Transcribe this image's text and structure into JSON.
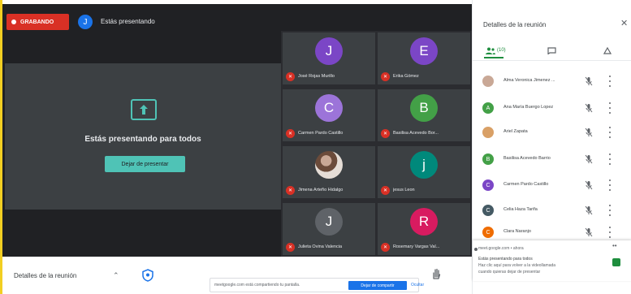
{
  "recording": {
    "label": "GRABANDO"
  },
  "presenter": {
    "initial": "J",
    "text": "Estás presentando"
  },
  "main": {
    "title": "Estás presentando para todos",
    "stop_button": "Dejar de presentar"
  },
  "tiles": [
    {
      "initial": "J",
      "name": "José Rojas Murillo",
      "color": "#7b46c6"
    },
    {
      "initial": "E",
      "name": "Erika Gómez",
      "color": "#7b46c6"
    },
    {
      "initial": "C",
      "name": "Carmen Pardo Castillo",
      "color": "#9c74d9"
    },
    {
      "initial": "B",
      "name": "Basilisa Acevedo Bor...",
      "color": "#43a047"
    },
    {
      "initial": "",
      "name": "Jimena Arteño Hidalgo",
      "color": "#e0d5cc"
    },
    {
      "initial": "j",
      "name": "jesus Leon",
      "color": "#00897b"
    },
    {
      "initial": "J",
      "name": "Julieta Ovina Valencia",
      "color": "#5f6368"
    },
    {
      "initial": "R",
      "name": "Rosemary Vargas Val...",
      "color": "#d81b60"
    }
  ],
  "bottom": {
    "details_label": "Detalles de la reunión",
    "notification_text": "meetgoogle.com está compartiendo tu pantalla.",
    "stop_share_button": "Dejar de compartir",
    "hide_link": "Ocultar"
  },
  "sidebar": {
    "title": "Detalles de la reunión",
    "tab_people_count": "(10)",
    "participants": [
      {
        "initial": "",
        "name": "Alma Veronica Jimenez ...",
        "color": "#c9a896"
      },
      {
        "initial": "A",
        "name": "Ana María Buergo Lopez",
        "color": "#43a047"
      },
      {
        "initial": "",
        "name": "Ariel Zapata",
        "color": "#d9a066"
      },
      {
        "initial": "B",
        "name": "Basilisa Acevedo Barrio",
        "color": "#43a047"
      },
      {
        "initial": "C",
        "name": "Carmen Pardo Castillo",
        "color": "#7b46c6"
      },
      {
        "initial": "C",
        "name": "Celia Haza Tarifa",
        "color": "#455a64"
      },
      {
        "initial": "C",
        "name": "Clara Naranjo",
        "color": "#ef6c00"
      }
    ],
    "toast": {
      "source": "meet.google.com • ahora",
      "line1": "Estás presentando para todos",
      "line2": "Haz clic aquí para volver a la videollamada",
      "line3": "cuando quieras dejar de presentar"
    }
  },
  "colors": {
    "record_red": "#d93025",
    "accent_teal": "#4fc3b6",
    "meet_green": "#1e8e3e",
    "stage_bg": "#202124"
  },
  "icons": {
    "shield": "shield-icon",
    "hand": "raise-hand-icon",
    "close": "close-icon",
    "people": "people-icon",
    "chat": "chat-icon",
    "activities": "activities-icon",
    "mic_off": "mic-off-icon",
    "more": "more-vert-icon"
  }
}
